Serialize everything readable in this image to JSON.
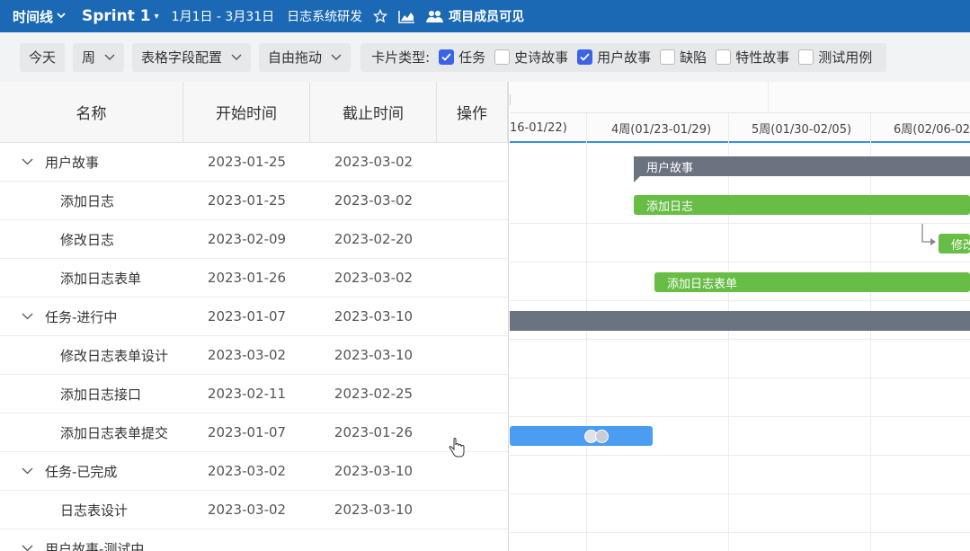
{
  "topbar": {
    "view_label": "时间线",
    "sprint_label": "Sprint 1",
    "date_range": "1月1日 - 3月31日",
    "project": "日志系统研发",
    "icons": [
      "star-icon",
      "chart-icon",
      "members-icon"
    ],
    "visibility": "项目成员可见"
  },
  "toolbar": {
    "today": "今天",
    "scale": "周",
    "field_config": "表格字段配置",
    "drag_mode": "自由拖动",
    "card_type_label": "卡片类型:",
    "card_types": [
      {
        "label": "任务",
        "checked": true
      },
      {
        "label": "史诗故事",
        "checked": false
      },
      {
        "label": "用户故事",
        "checked": true
      },
      {
        "label": "缺陷",
        "checked": false
      },
      {
        "label": "特性故事",
        "checked": false
      },
      {
        "label": "测试用例",
        "checked": false
      }
    ]
  },
  "table": {
    "columns": [
      "名称",
      "开始时间",
      "截止时间",
      "操作"
    ],
    "rows": [
      {
        "name": "用户故事",
        "start": "2023-01-25",
        "end": "2023-03-02",
        "group": true
      },
      {
        "name": "添加日志",
        "start": "2023-01-25",
        "end": "2023-03-02",
        "group": false
      },
      {
        "name": "修改日志",
        "start": "2023-02-09",
        "end": "2023-02-20",
        "group": false
      },
      {
        "name": "添加日志表单",
        "start": "2023-01-26",
        "end": "2023-03-02",
        "group": false
      },
      {
        "name": "任务-进行中",
        "start": "2023-01-07",
        "end": "2023-03-10",
        "group": true
      },
      {
        "name": "修改日志表单设计",
        "start": "2023-03-02",
        "end": "2023-03-10",
        "group": false
      },
      {
        "name": "添加日志接口",
        "start": "2023-02-11",
        "end": "2023-02-25",
        "group": false
      },
      {
        "name": "添加日志表单提交",
        "start": "2023-01-07",
        "end": "2023-01-26",
        "group": false
      },
      {
        "name": "任务-已完成",
        "start": "2023-03-02",
        "end": "2023-03-10",
        "group": true
      },
      {
        "name": "日志表设计",
        "start": "2023-03-02",
        "end": "2023-03-10",
        "group": false
      },
      {
        "name": "用户故事-测试中",
        "start": "",
        "end": "",
        "group": true
      }
    ]
  },
  "gantt": {
    "weeks": [
      "16-01/22)",
      "4周(01/23-01/29)",
      "5周(01/30-02/05)",
      "6周(02/06-02"
    ],
    "bars": [
      {
        "label": "用户故事",
        "color": "#6b7280"
      },
      {
        "label": "添加日志",
        "color": "#67bd45"
      },
      {
        "label": "修改",
        "color": "#67bd45"
      },
      {
        "label": "添加日志表单",
        "color": "#67bd45"
      },
      {
        "label": "",
        "color": "#6b7280"
      },
      {
        "label": "",
        "color": "#4a9df0"
      }
    ]
  }
}
